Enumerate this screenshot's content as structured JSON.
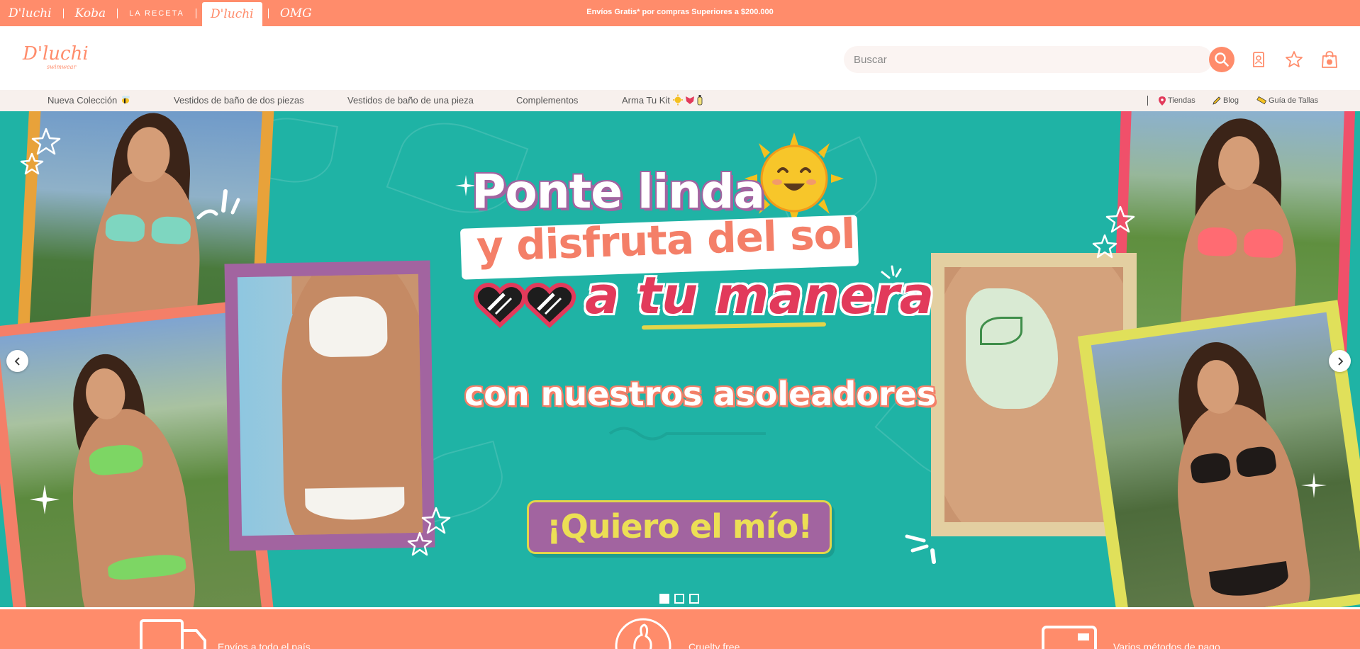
{
  "topbar": {
    "brands": [
      {
        "label": "D'luchi",
        "active": false
      },
      {
        "label": "Koba",
        "active": false
      },
      {
        "label": "LA RECETA",
        "active": false
      },
      {
        "label": "D'luchi",
        "active": true
      },
      {
        "label": "OMG",
        "active": false
      }
    ],
    "promo": "Envíos Gratis* por compras Superiores a $200.000"
  },
  "header": {
    "logo_text": "D'luchi",
    "logo_sub": "swimwear",
    "search_placeholder": "Buscar",
    "cart_count": "0"
  },
  "nav": {
    "items": [
      "Nueva Colección",
      "Vestidos de baño de dos piezas",
      "Vestidos de baño de una pieza",
      "Complementos",
      "Arma Tu Kit"
    ],
    "right": [
      "Tiendas",
      "Blog",
      "Guía de Tallas"
    ]
  },
  "hero": {
    "line1": "Ponte linda",
    "line2": "y disfruta del sol",
    "line3": "a tu manera",
    "line4": "con nuestros asoleadores",
    "cta": "¡Quiero el mío!",
    "slides_total": 3,
    "active_slide": 1
  },
  "benefits": [
    {
      "label": "Envíos a todo el país",
      "icon": "truck-icon"
    },
    {
      "label": "Cruelty free",
      "icon": "rabbit-icon"
    },
    {
      "label": "Varios métodos de pago",
      "icon": "card-icon"
    }
  ],
  "colors": {
    "brand": "#ff8c6b",
    "hero_bg": "#1fb3a5",
    "purple": "#a264a0",
    "pink": "#e23a5b",
    "yellow": "#e3d54a"
  }
}
